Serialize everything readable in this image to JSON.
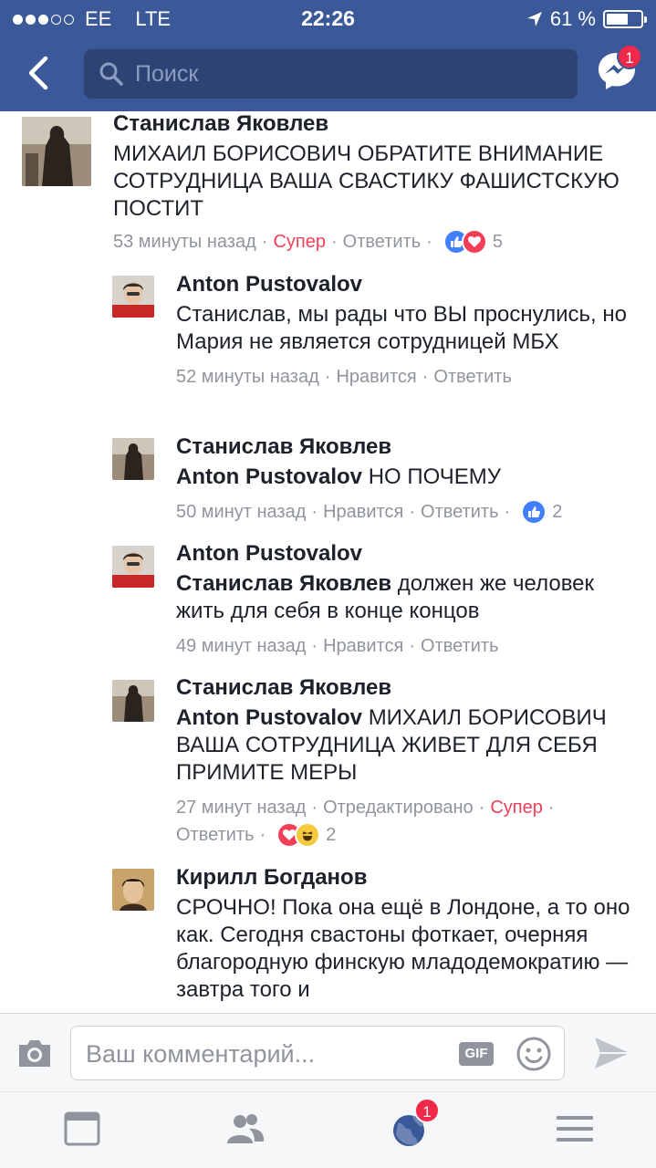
{
  "status_bar": {
    "carrier": "EE",
    "network": "LTE",
    "time": "22:26",
    "battery": "61 %"
  },
  "header": {
    "search_placeholder": "Поиск",
    "messenger_badge": "1"
  },
  "comments": [
    {
      "author": "Станислав Яковлев",
      "text": "МИХАИЛ БОРИСОВИЧ ОБРАТИТЕ ВНИМАНИЕ СОТРУДНИЦА ВАША СВАСТИКУ ФАШИСТСКУЮ ПОСТИТ",
      "time": "53 минуты назад",
      "reaction_label": "Супер",
      "reply": "Ответить",
      "reactions": [
        "like",
        "love"
      ],
      "reaction_count": "5"
    },
    {
      "author": "Anton Pustovalov",
      "text": "Станислав, мы рады что ВЫ проснулись, но Мария не является сотрудницей МБХ",
      "time": "52 минуты назад",
      "like": "Нравится",
      "reply": "Ответить"
    },
    {
      "author": "Станислав Яковлев",
      "mention": "Anton Pustovalov",
      "text": "НО ПОЧЕМУ",
      "time": "50 минут назад",
      "like": "Нравится",
      "reply": "Ответить",
      "reactions": [
        "like"
      ],
      "reaction_count": "2"
    },
    {
      "author": "Anton Pustovalov",
      "mention": "Станислав Яковлев",
      "text": "должен же человек жить для себя в конце концов",
      "time": "49 минут назад",
      "like": "Нравится",
      "reply": "Ответить"
    },
    {
      "author": "Станислав Яковлев",
      "mention": "Anton Pustovalov",
      "text": "МИХАИЛ БОРИСОВИЧ ВАША СОТРУДНИЦА ЖИВЕТ ДЛЯ СЕБЯ ПРИМИТЕ МЕРЫ",
      "time": "27 минут назад",
      "edited": "Отредактировано",
      "reaction_label": "Супер",
      "reply": "Ответить",
      "reactions": [
        "love",
        "haha"
      ],
      "reaction_count": "2"
    },
    {
      "author": "Кирилл Богданов",
      "text": "СРОЧНО! Пока она ещё в Лондоне, а то оно как. Сегодня свастоны фоткает, очерняя благородную финскую младодемократию — завтра того и"
    }
  ],
  "composer": {
    "placeholder": "Ваш комментарий...",
    "gif_label": "GIF"
  },
  "tabbar": {
    "notifications_badge": "1"
  },
  "colors": {
    "brand": "#3b5998",
    "love": "#f33e58",
    "like": "#4080ff",
    "badge": "#f02849"
  }
}
